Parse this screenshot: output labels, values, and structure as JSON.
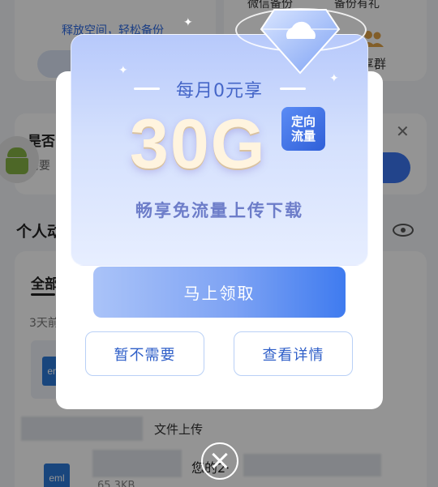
{
  "background": {
    "promo_tip": "释放空间，轻松备份",
    "wechat_backup": "微信备份",
    "backup_more": "备份有礼",
    "group_label": "享群",
    "banner_title": "是否",
    "banner_sub": "需要",
    "banner_close": "✕",
    "section_title": "个人动",
    "tab_all": "全部",
    "days_label": "3天前",
    "file_badge": "eml",
    "upload_label": "文件上传",
    "partial_name": "您的2·",
    "file_size": "65.3KB"
  },
  "dialog": {
    "subtitle": "每月0元享",
    "amount": "30G",
    "tag": "定向流量",
    "description": "畅享免流量上传下载",
    "claim_button": "马上领取",
    "decline_button": "暂不需要",
    "details_button": "查看详情"
  },
  "colors": {
    "accent": "#3f7bef",
    "dialog_text_blue": "#4566c8",
    "secondary_border": "#b9d0f6"
  },
  "icons": [
    "cloud-gem-icon",
    "android-icon",
    "eye-icon",
    "close-circle-icon",
    "group-icon"
  ]
}
